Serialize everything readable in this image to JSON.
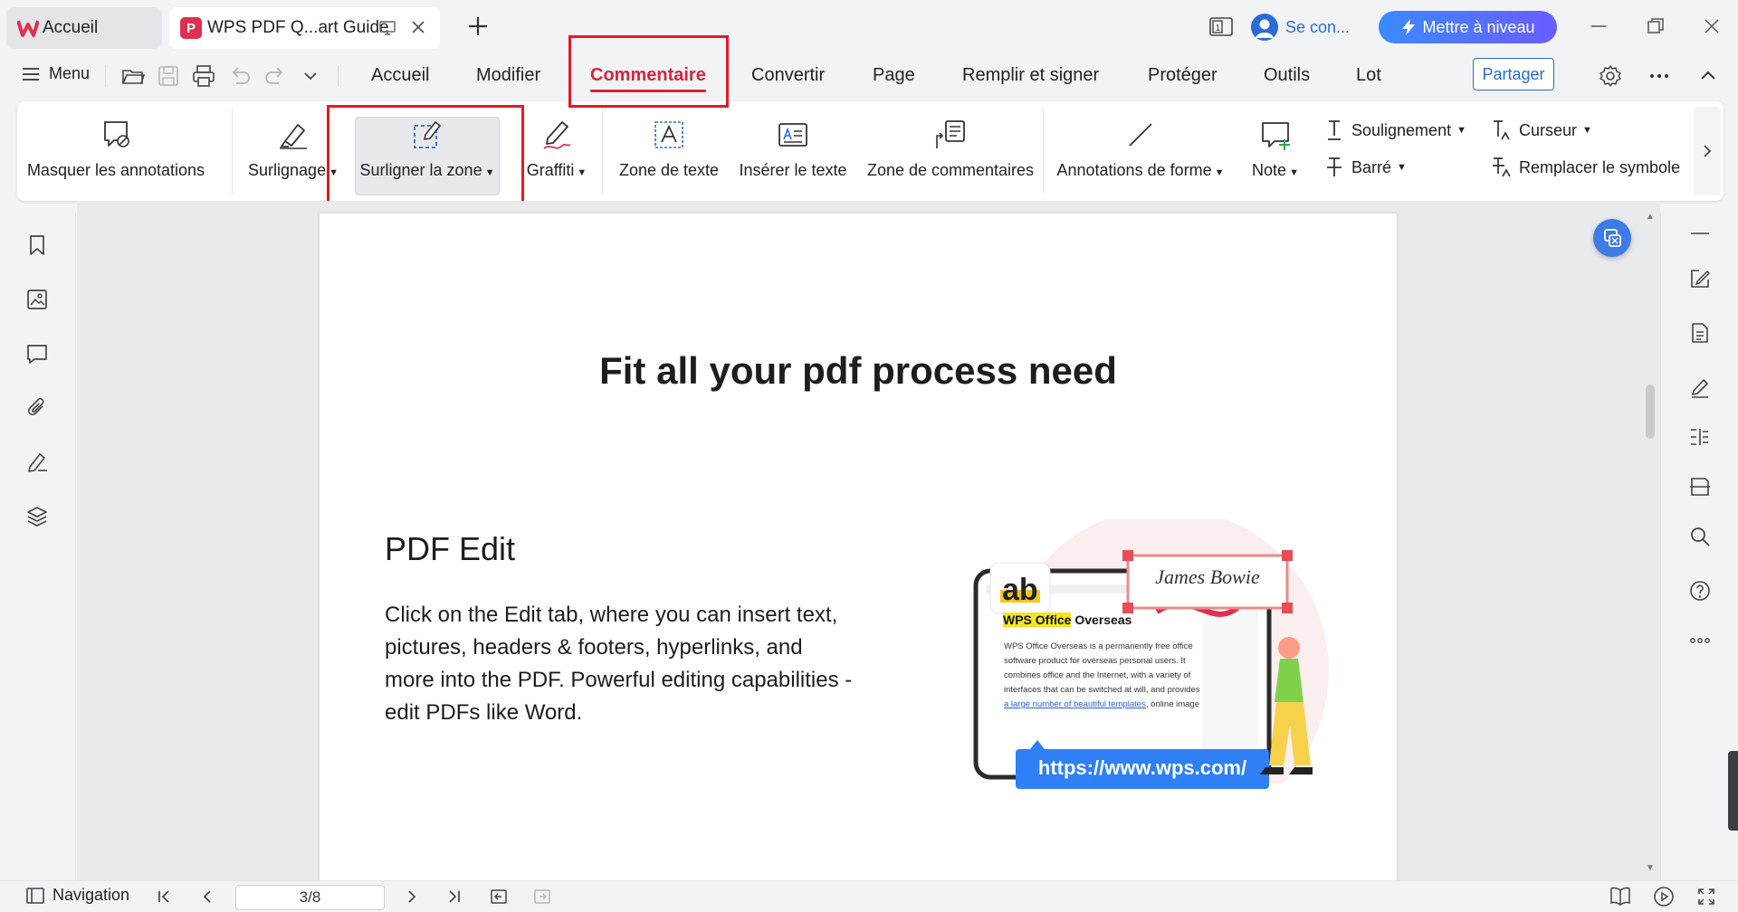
{
  "titlebar": {
    "tabs": [
      {
        "label": "Accueil"
      },
      {
        "label": "WPS PDF Q...art Guide"
      }
    ],
    "account_label": "Se con...",
    "upgrade_label": "Mettre à niveau"
  },
  "menubar": {
    "menu_label": "Menu",
    "tabs": [
      {
        "label": "Accueil"
      },
      {
        "label": "Modifier"
      },
      {
        "label": "Commentaire"
      },
      {
        "label": "Convertir"
      },
      {
        "label": "Page"
      },
      {
        "label": "Remplir et signer"
      },
      {
        "label": "Protéger"
      },
      {
        "label": "Outils"
      },
      {
        "label": "Lot"
      }
    ],
    "active_tab": "Commentaire",
    "share_label": "Partager"
  },
  "ribbon": {
    "items": [
      {
        "label": "Masquer les annotations"
      },
      {
        "label": "Surlignage"
      },
      {
        "label": "Surligner la zone"
      },
      {
        "label": "Graffiti"
      },
      {
        "label": "Zone de texte"
      },
      {
        "label": "Insérer le texte"
      },
      {
        "label": "Zone de commentaires"
      },
      {
        "label": "Annotations de forme"
      },
      {
        "label": "Note"
      }
    ],
    "small_items": [
      {
        "label": "Soulignement"
      },
      {
        "label": "Barré"
      },
      {
        "label": "Curseur"
      },
      {
        "label": "Remplacer le symbole"
      }
    ],
    "selected_tool": "Surligner la zone"
  },
  "document": {
    "title": "Fit all your pdf process need",
    "section_title": "PDF Edit",
    "section_body": "Click on the Edit tab, where you can insert text, pictures, headers & footers, hyperlinks, and more into the PDF. Powerful editing capabilities - edit PDFs like Word.",
    "illustration": {
      "badge": "ab",
      "signature": "James Bowie",
      "heading_highlight": "WPS Office",
      "heading_rest": " Overseas",
      "lines": [
        "WPS Office Overseas is a permanently free office",
        "software product for overseas personal users. It",
        "combines office and the Internet, with a variety of",
        "interfaces that can be switched at will, and provides"
      ],
      "link_line": "a large number of beautiful templates",
      "link_tail": ", online image",
      "url": "https://www.wps.com/"
    }
  },
  "statusbar": {
    "navigation_label": "Navigation",
    "page_value": "3/8"
  },
  "colors": {
    "accent_red": "#d6243c",
    "highlight_box": "#e31b23",
    "brand_blue": "#2a6bd8"
  }
}
